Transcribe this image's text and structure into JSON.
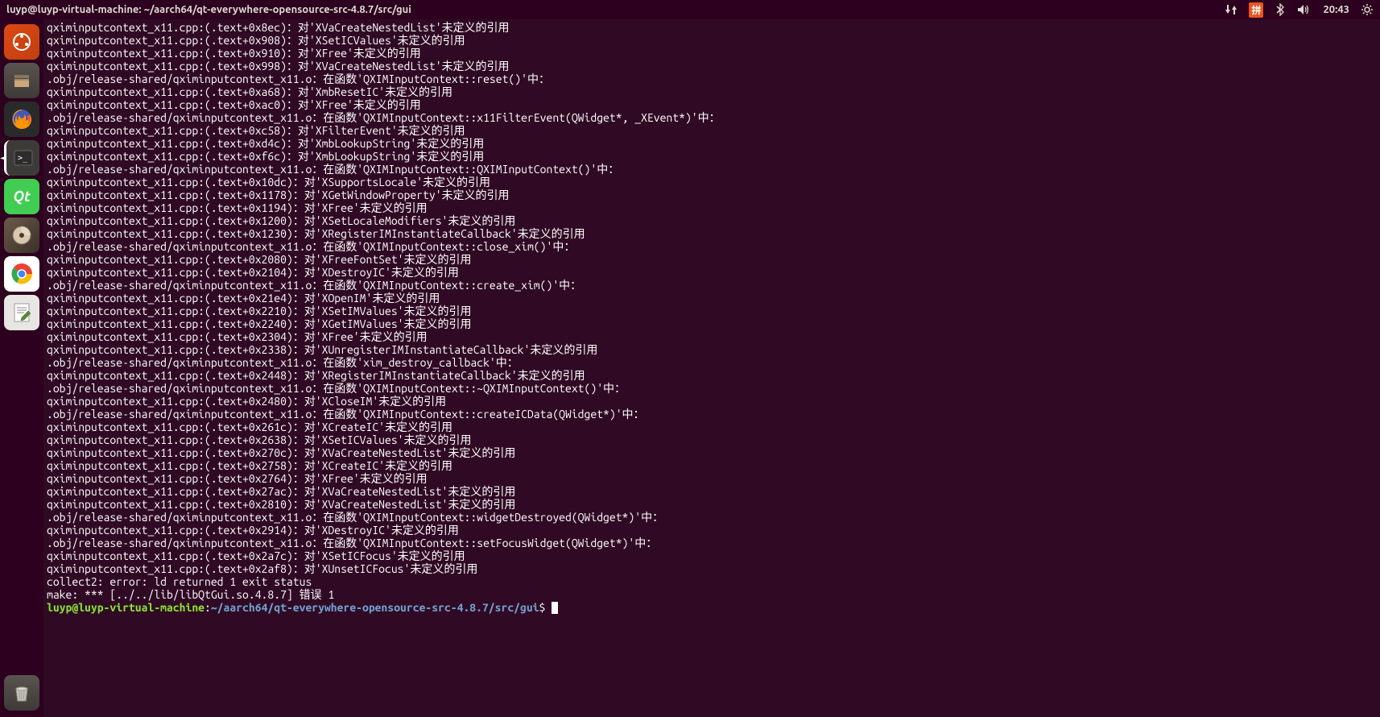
{
  "menubar": {
    "title": "luyp@luyp-virtual-machine: ~/aarch64/qt-everywhere-opensource-src-4.8.7/src/gui",
    "time": "20:43",
    "lang": "拼"
  },
  "launcher": {
    "dash": "◐",
    "files": "🗄",
    "firefox": "🦊",
    "terminal": ">_",
    "qt": "Qt",
    "disc": "◉",
    "chrome": "◉",
    "gedit": "✎",
    "trash": "🗑"
  },
  "terminal": {
    "lines": [
      "qximinputcontext_x11.cpp:(.text+0x8ec)：对'XVaCreateNestedList'未定义的引用",
      "qximinputcontext_x11.cpp:(.text+0x908)：对'XSetICValues'未定义的引用",
      "qximinputcontext_x11.cpp:(.text+0x910)：对'XFree'未定义的引用",
      "qximinputcontext_x11.cpp:(.text+0x998)：对'XVaCreateNestedList'未定义的引用",
      ".obj/release-shared/qximinputcontext_x11.o：在函数'QXIMInputContext::reset()'中：",
      "qximinputcontext_x11.cpp:(.text+0xa68)：对'XmbResetIC'未定义的引用",
      "qximinputcontext_x11.cpp:(.text+0xac0)：对'XFree'未定义的引用",
      ".obj/release-shared/qximinputcontext_x11.o：在函数'QXIMInputContext::x11FilterEvent(QWidget*, _XEvent*)'中：",
      "qximinputcontext_x11.cpp:(.text+0xc58)：对'XFilterEvent'未定义的引用",
      "qximinputcontext_x11.cpp:(.text+0xd4c)：对'XmbLookupString'未定义的引用",
      "qximinputcontext_x11.cpp:(.text+0xf6c)：对'XmbLookupString'未定义的引用",
      ".obj/release-shared/qximinputcontext_x11.o：在函数'QXIMInputContext::QXIMInputContext()'中：",
      "qximinputcontext_x11.cpp:(.text+0x10dc)：对'XSupportsLocale'未定义的引用",
      "qximinputcontext_x11.cpp:(.text+0x1178)：对'XGetWindowProperty'未定义的引用",
      "qximinputcontext_x11.cpp:(.text+0x1194)：对'XFree'未定义的引用",
      "qximinputcontext_x11.cpp:(.text+0x1200)：对'XSetLocaleModifiers'未定义的引用",
      "qximinputcontext_x11.cpp:(.text+0x1230)：对'XRegisterIMInstantiateCallback'未定义的引用",
      ".obj/release-shared/qximinputcontext_x11.o：在函数'QXIMInputContext::close_xim()'中：",
      "qximinputcontext_x11.cpp:(.text+0x2080)：对'XFreeFontSet'未定义的引用",
      "qximinputcontext_x11.cpp:(.text+0x2104)：对'XDestroyIC'未定义的引用",
      ".obj/release-shared/qximinputcontext_x11.o：在函数'QXIMInputContext::create_xim()'中：",
      "qximinputcontext_x11.cpp:(.text+0x21e4)：对'XOpenIM'未定义的引用",
      "qximinputcontext_x11.cpp:(.text+0x2210)：对'XSetIMValues'未定义的引用",
      "qximinputcontext_x11.cpp:(.text+0x2240)：对'XGetIMValues'未定义的引用",
      "qximinputcontext_x11.cpp:(.text+0x2304)：对'XFree'未定义的引用",
      "qximinputcontext_x11.cpp:(.text+0x2338)：对'XUnregisterIMInstantiateCallback'未定义的引用",
      ".obj/release-shared/qximinputcontext_x11.o：在函数'xim_destroy_callback'中：",
      "qximinputcontext_x11.cpp:(.text+0x2448)：对'XRegisterIMInstantiateCallback'未定义的引用",
      ".obj/release-shared/qximinputcontext_x11.o：在函数'QXIMInputContext::~QXIMInputContext()'中：",
      "qximinputcontext_x11.cpp:(.text+0x2480)：对'XCloseIM'未定义的引用",
      ".obj/release-shared/qximinputcontext_x11.o：在函数'QXIMInputContext::createICData(QWidget*)'中：",
      "qximinputcontext_x11.cpp:(.text+0x261c)：对'XCreateIC'未定义的引用",
      "qximinputcontext_x11.cpp:(.text+0x2638)：对'XSetICValues'未定义的引用",
      "qximinputcontext_x11.cpp:(.text+0x270c)：对'XVaCreateNestedList'未定义的引用",
      "qximinputcontext_x11.cpp:(.text+0x2758)：对'XCreateIC'未定义的引用",
      "qximinputcontext_x11.cpp:(.text+0x2764)：对'XFree'未定义的引用",
      "qximinputcontext_x11.cpp:(.text+0x27ac)：对'XVaCreateNestedList'未定义的引用",
      "qximinputcontext_x11.cpp:(.text+0x2810)：对'XVaCreateNestedList'未定义的引用",
      ".obj/release-shared/qximinputcontext_x11.o：在函数'QXIMInputContext::widgetDestroyed(QWidget*)'中：",
      "qximinputcontext_x11.cpp:(.text+0x2914)：对'XDestroyIC'未定义的引用",
      ".obj/release-shared/qximinputcontext_x11.o：在函数'QXIMInputContext::setFocusWidget(QWidget*)'中：",
      "qximinputcontext_x11.cpp:(.text+0x2a7c)：对'XSetICFocus'未定义的引用",
      "qximinputcontext_x11.cpp:(.text+0x2af8)：对'XUnsetICFocus'未定义的引用",
      "collect2: error: ld returned 1 exit status",
      "make: *** [../../lib/libQtGui.so.4.8.7] 错误 1"
    ],
    "prompt": {
      "userhost": "luyp@luyp-virtual-machine",
      "sep": ":",
      "path": "~/aarch64/qt-everywhere-opensource-src-4.8.7/src/gui",
      "dollar": "$ "
    }
  }
}
